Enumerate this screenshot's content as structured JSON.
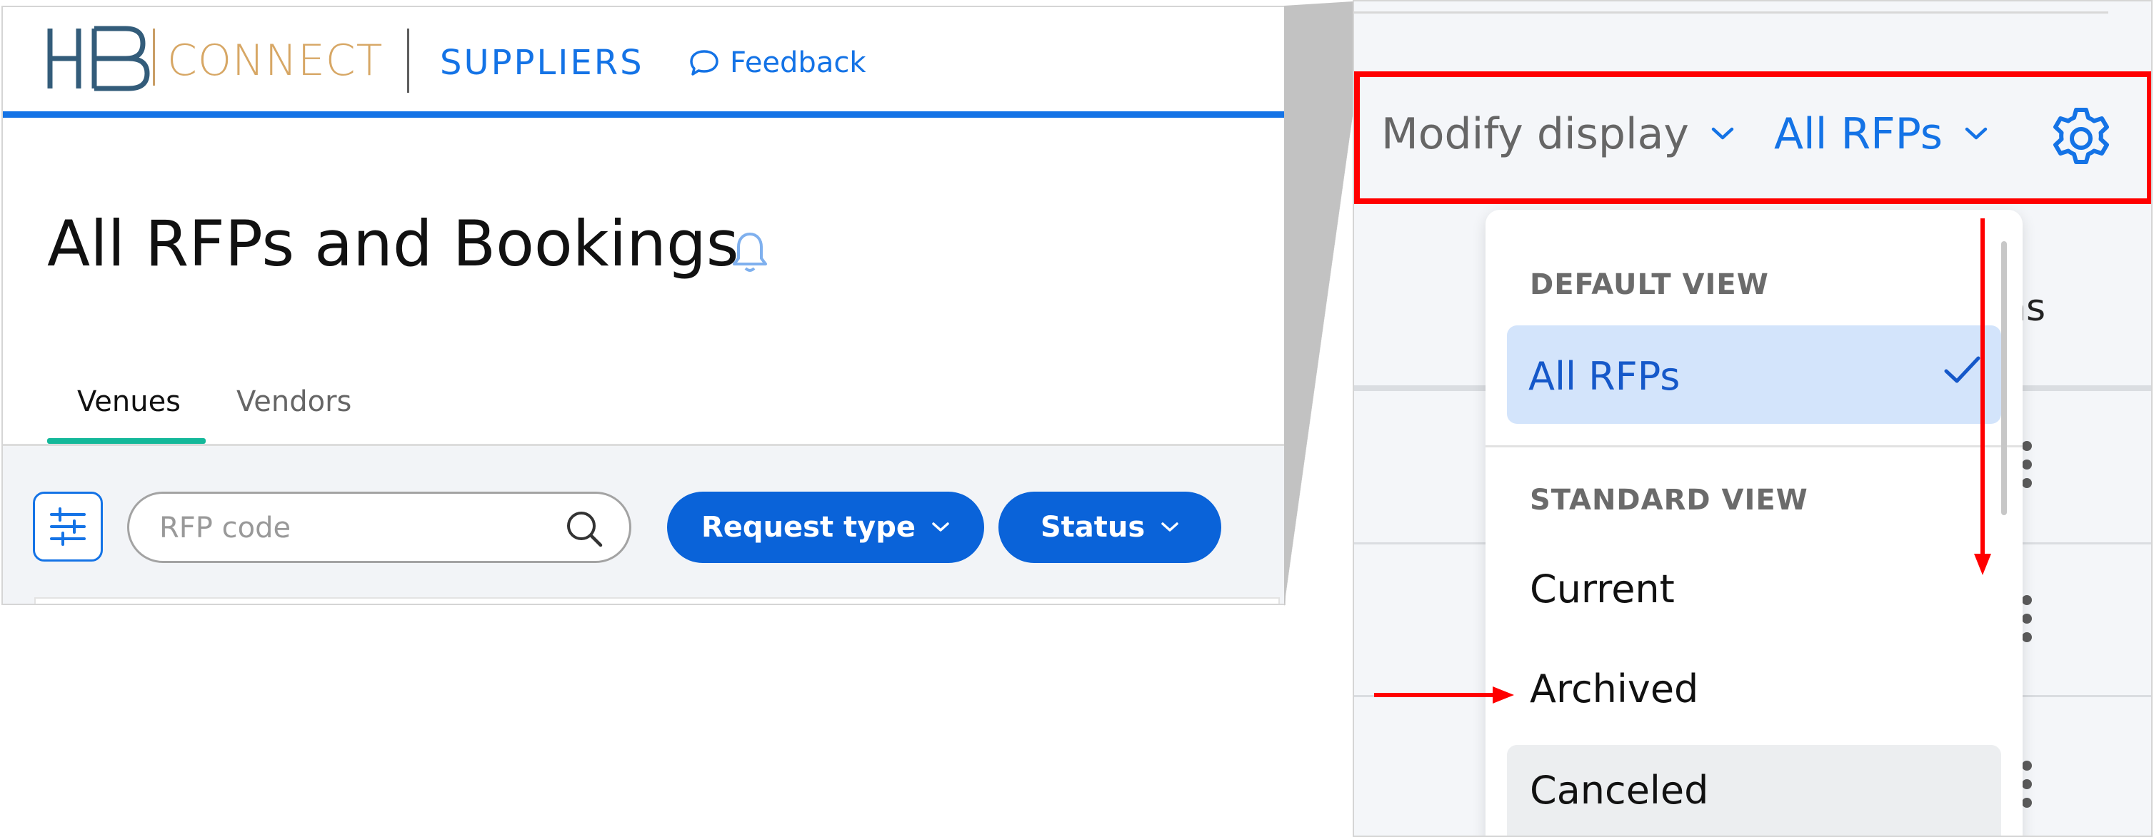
{
  "left": {
    "logo": {
      "mark": "HB",
      "text": "CONNECT"
    },
    "nav": {
      "section": "SUPPLIERS",
      "feedback": "Feedback"
    },
    "page_title": "All RFPs and Bookings",
    "tabs": [
      {
        "label": "Venues",
        "active": true
      },
      {
        "label": "Vendors",
        "active": false
      }
    ],
    "filters": {
      "search_placeholder": "RFP code",
      "request_type": "Request type",
      "status": "Status"
    }
  },
  "right": {
    "toolbar": {
      "modify_display": "Modify display",
      "view": "All RFPs"
    },
    "column_header_partial": "ns",
    "dropdown": {
      "default_section": "DEFAULT VIEW",
      "default_item": "All RFPs",
      "standard_section": "STANDARD VIEW",
      "standard_items": [
        "Current",
        "Archived",
        "Canceled"
      ]
    }
  },
  "colors": {
    "brand_blue": "#1473e6",
    "button_blue": "#0a63d9",
    "logo_gold": "#d7a765",
    "logo_navy": "#335c7a",
    "tab_accent": "#14b89a",
    "highlight_red": "#ff0000",
    "selected_bg": "#d3e4fb"
  }
}
